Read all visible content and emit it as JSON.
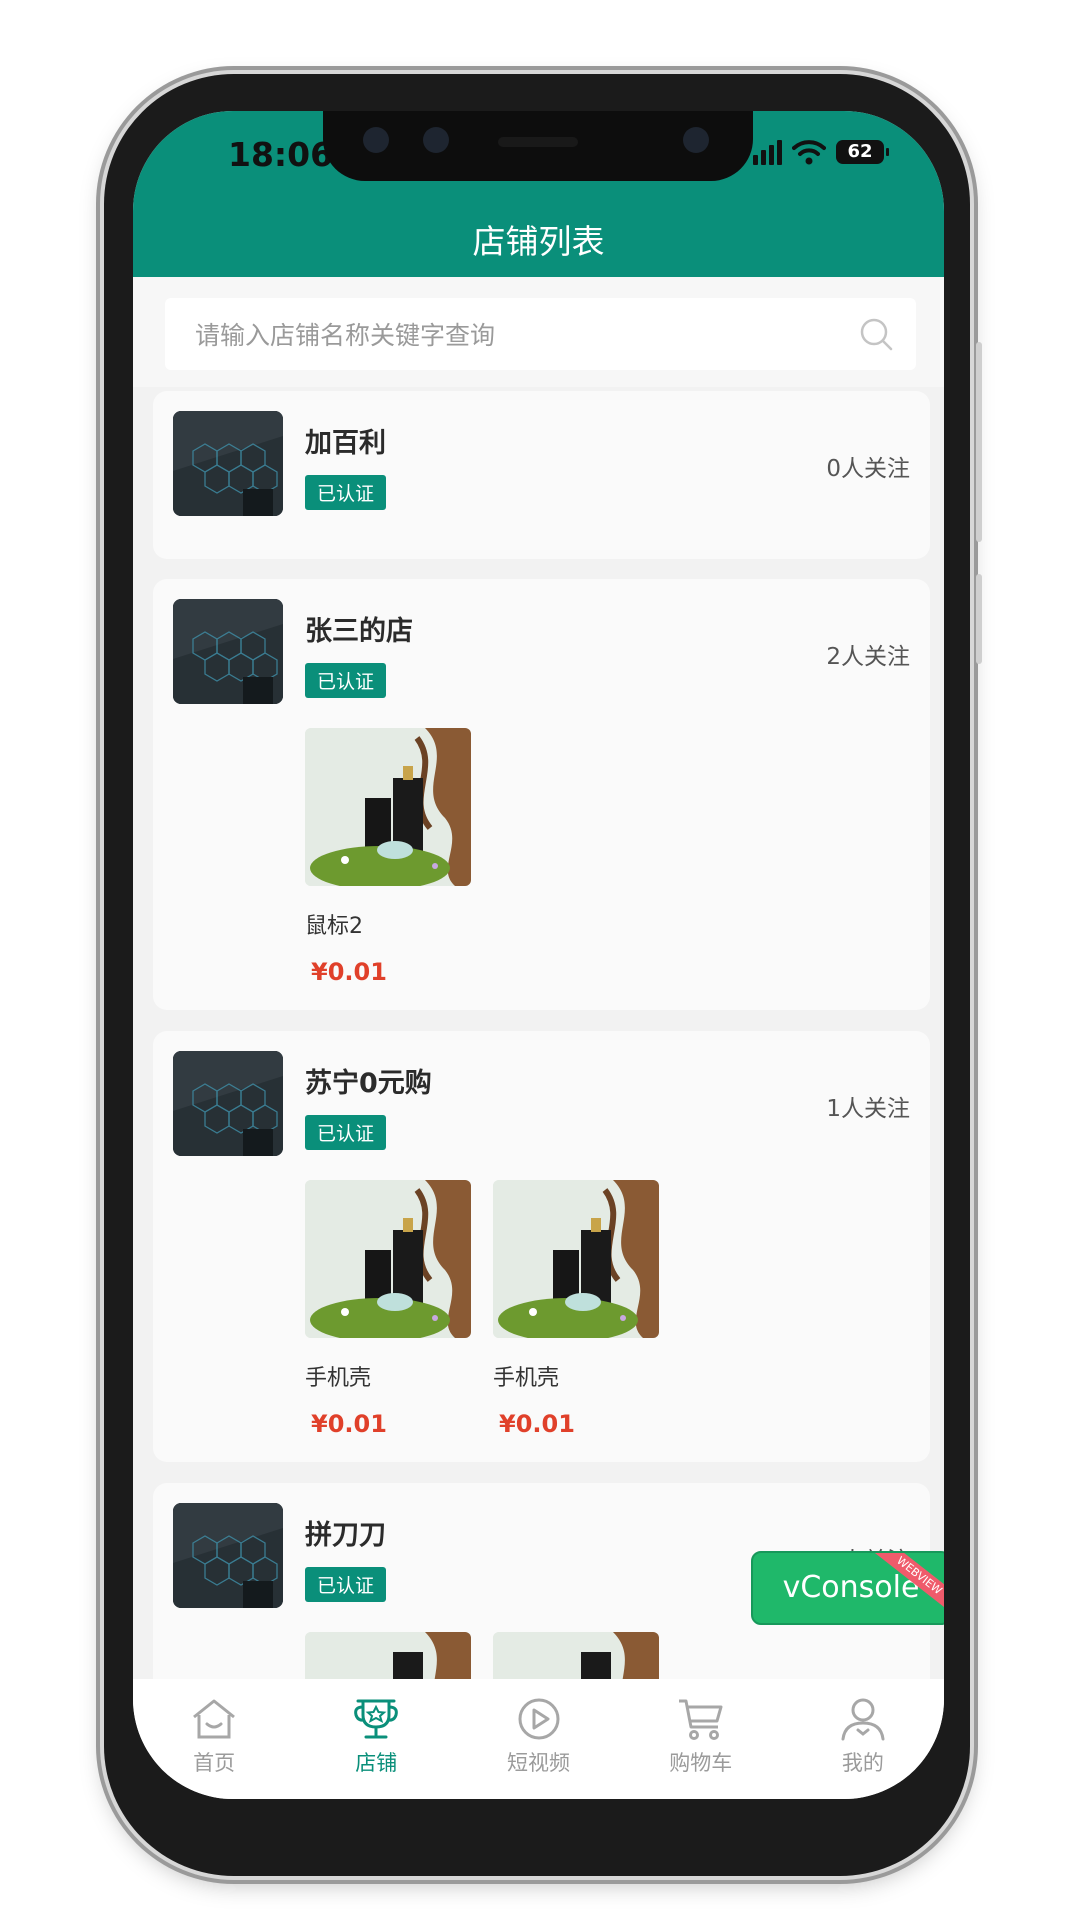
{
  "status_bar": {
    "time": "18:06",
    "battery": "62"
  },
  "header": {
    "title": "店铺列表"
  },
  "search": {
    "placeholder": "请输入店铺名称关键字查询",
    "icon": "search-icon"
  },
  "shops": [
    {
      "name": "加百利",
      "badge": "已认证",
      "follows": "0人关注",
      "products": []
    },
    {
      "name": "张三的店",
      "badge": "已认证",
      "follows": "2人关注",
      "products": [
        {
          "name": "鼠标2",
          "price": "¥0.01"
        }
      ]
    },
    {
      "name": "苏宁0元购",
      "badge": "已认证",
      "follows": "1人关注",
      "products": [
        {
          "name": "手机壳",
          "price": "¥0.01"
        },
        {
          "name": "手机壳",
          "price": "¥0.01"
        }
      ]
    },
    {
      "name": "拼刀刀",
      "badge": "已认证",
      "follows": "1人关注",
      "products": []
    }
  ],
  "vconsole": {
    "label": "vConsole",
    "ribbon": "WEBVIEW"
  },
  "tabbar": [
    {
      "label": "首页",
      "icon": "home-icon",
      "active": false
    },
    {
      "label": "店铺",
      "icon": "shop-trophy-icon",
      "active": true
    },
    {
      "label": "短视频",
      "icon": "play-icon",
      "active": false
    },
    {
      "label": "购物车",
      "icon": "cart-icon",
      "active": false
    },
    {
      "label": "我的",
      "icon": "user-icon",
      "active": false
    }
  ],
  "colors": {
    "brand": "#0a8f7a",
    "price": "#e0402a",
    "vconsole": "#1fb86a"
  }
}
